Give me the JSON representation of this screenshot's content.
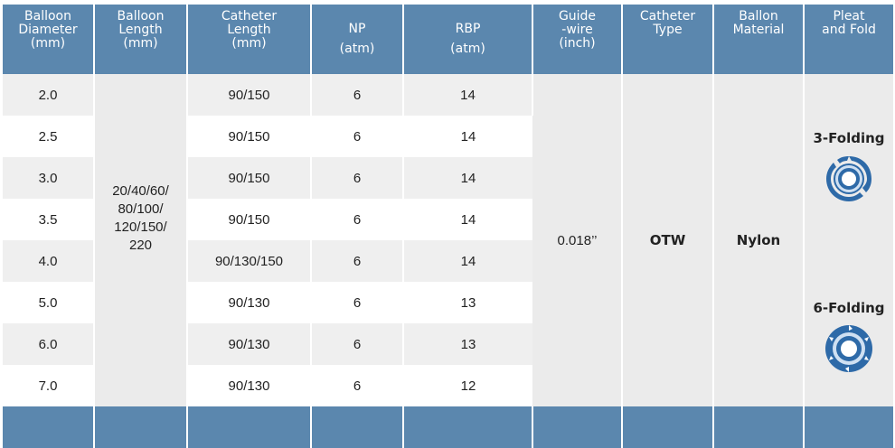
{
  "headers": [
    {
      "key": "diameter",
      "lines": [
        "Balloon",
        "Diameter",
        "(mm)"
      ]
    },
    {
      "key": "length",
      "lines": [
        "Balloon",
        "Length",
        "(mm)"
      ]
    },
    {
      "key": "catheter_length",
      "lines": [
        "Catheter",
        "Length",
        "(mm)"
      ]
    },
    {
      "key": "np",
      "lines": [
        "NP",
        "(atm)"
      ]
    },
    {
      "key": "rbp",
      "lines": [
        "RBP",
        "(atm)"
      ]
    },
    {
      "key": "guidewire",
      "lines": [
        "Guide",
        "-wire",
        "(inch)"
      ]
    },
    {
      "key": "catheter_type",
      "lines": [
        "Catheter",
        "Type"
      ]
    },
    {
      "key": "material",
      "lines": [
        "Ballon",
        "Material"
      ]
    },
    {
      "key": "pleat",
      "lines": [
        "Pleat",
        "and Fold"
      ]
    }
  ],
  "rows": [
    {
      "diameter": "2.0",
      "catheter_length": "90/150",
      "np": "6",
      "rbp": "14"
    },
    {
      "diameter": "2.5",
      "catheter_length": "90/150",
      "np": "6",
      "rbp": "14"
    },
    {
      "diameter": "3.0",
      "catheter_length": "90/150",
      "np": "6",
      "rbp": "14"
    },
    {
      "diameter": "3.5",
      "catheter_length": "90/150",
      "np": "6",
      "rbp": "14"
    },
    {
      "diameter": "4.0",
      "catheter_length": "90/130/150",
      "np": "6",
      "rbp": "14"
    },
    {
      "diameter": "5.0",
      "catheter_length": "90/130",
      "np": "6",
      "rbp": "13"
    },
    {
      "diameter": "6.0",
      "catheter_length": "90/130",
      "np": "6",
      "rbp": "13"
    },
    {
      "diameter": "7.0",
      "catheter_length": "90/130",
      "np": "6",
      "rbp": "12"
    }
  ],
  "merged": {
    "balloon_length_lines": [
      "20/40/60/",
      "80/100/",
      "120/150/",
      "220"
    ],
    "guidewire": "0.018’’",
    "catheter_type": "OTW",
    "material": "Nylon"
  },
  "pleat": {
    "three_fold_label": "3-Folding",
    "six_fold_label": "6-Folding",
    "three_fold_icon": "three-fold-balloon-cross-section-icon",
    "six_fold_icon": "six-fold-balloon-cross-section-icon"
  },
  "colors": {
    "header_bg": "#5b87ae",
    "header_text": "#ffffff",
    "row_alt": "#efefef",
    "merged_bg": "#ebebeb",
    "icon_blue": "#2e6aa8"
  }
}
